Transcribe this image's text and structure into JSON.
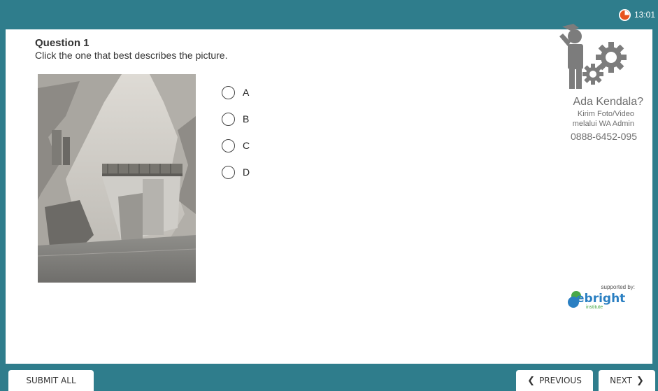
{
  "topbar": {
    "timer": "13:01",
    "timer_icon": "stopwatch-icon"
  },
  "question": {
    "title": "Question 1",
    "prompt": "Click the one that best describes the picture.",
    "image_alt_icon": "photo-dam"
  },
  "options": [
    {
      "label": "A",
      "selected": false
    },
    {
      "label": "B",
      "selected": false
    },
    {
      "label": "C",
      "selected": false
    },
    {
      "label": "D",
      "selected": false
    }
  ],
  "help": {
    "title": "Ada Kendala?",
    "line1": "Kirim Foto/Video",
    "line2": "melalui WA Admin",
    "phone": "0888-6452-095",
    "icon": "confused-person-gears-icon"
  },
  "sponsor": {
    "supported_by": "supported by:",
    "brand": "ebright",
    "brand_sub": "institute"
  },
  "footer": {
    "submit_all": "SUBMIT ALL",
    "previous": "PREVIOUS",
    "next": "NEXT"
  },
  "colors": {
    "accent": "#2f7d8c",
    "timer": "#e8541e",
    "brand_blue": "#2a7fc2",
    "brand_green": "#48a848"
  }
}
